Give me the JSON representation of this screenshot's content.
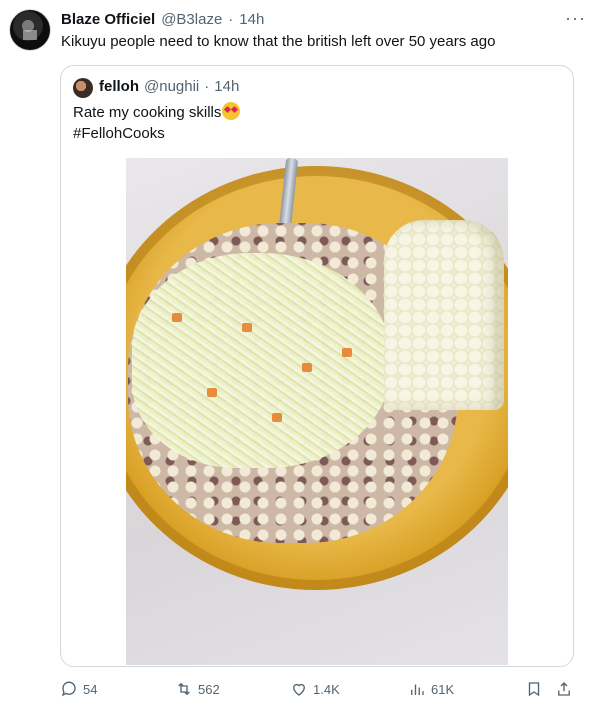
{
  "tweet": {
    "author_name": "Blaze Officiel",
    "handle": "@B3laze",
    "separator": "·",
    "time": "14h",
    "text": "Kikuyu people need to know that the british left over 50 years ago",
    "more_icon": "···"
  },
  "quote": {
    "author_name": "felloh",
    "handle": "@nughii",
    "separator": "·",
    "time": "14h",
    "line1": "Rate my cooking skills",
    "line2": "#FellohCooks",
    "emoji": "heart-eyes-emoji"
  },
  "actions": {
    "replies": "54",
    "reposts": "562",
    "likes": "1.4K",
    "views": "61K"
  }
}
